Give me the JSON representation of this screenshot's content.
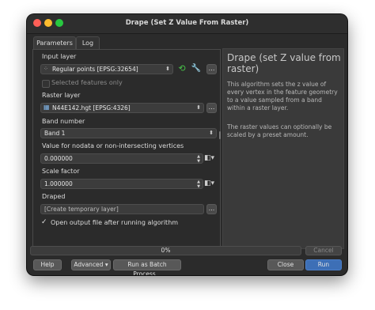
{
  "window": {
    "title": "Drape (Set Z Value From Raster)"
  },
  "tabs": [
    "Parameters",
    "Log"
  ],
  "input_layer": {
    "label": "Input layer",
    "value": "Regular points [EPSG:32654]",
    "selected_only": "Selected features only"
  },
  "raster_layer": {
    "label": "Raster layer",
    "value": "N44E142.hgt [EPSG:4326]"
  },
  "band": {
    "label": "Band number",
    "value": "Band 1"
  },
  "nodata": {
    "label": "Value for nodata or non-intersecting vertices",
    "value": "0.000000"
  },
  "scale": {
    "label": "Scale factor",
    "value": "1.000000"
  },
  "draped": {
    "label": "Draped",
    "value": "[Create temporary layer]",
    "browse": "..."
  },
  "open_output": {
    "label": "Open output file after running algorithm",
    "checked": true
  },
  "help": {
    "title": "Drape (set Z value from raster)",
    "para1": "This algorithm sets the z value of every vertex in the feature geometry to a value sampled from a band within a raster layer.",
    "para2": "The raster values can optionally be scaled by a preset amount."
  },
  "progress": {
    "value": 0,
    "text": "0%"
  },
  "buttons": {
    "help": "Help",
    "advanced": "Advanced",
    "batch": "Run as Batch Process...",
    "close": "Close",
    "run": "Run",
    "cancel": "Cancel"
  },
  "colors": {
    "run_button": "#3d6fb6",
    "window_bg": "#2b2b2b"
  }
}
